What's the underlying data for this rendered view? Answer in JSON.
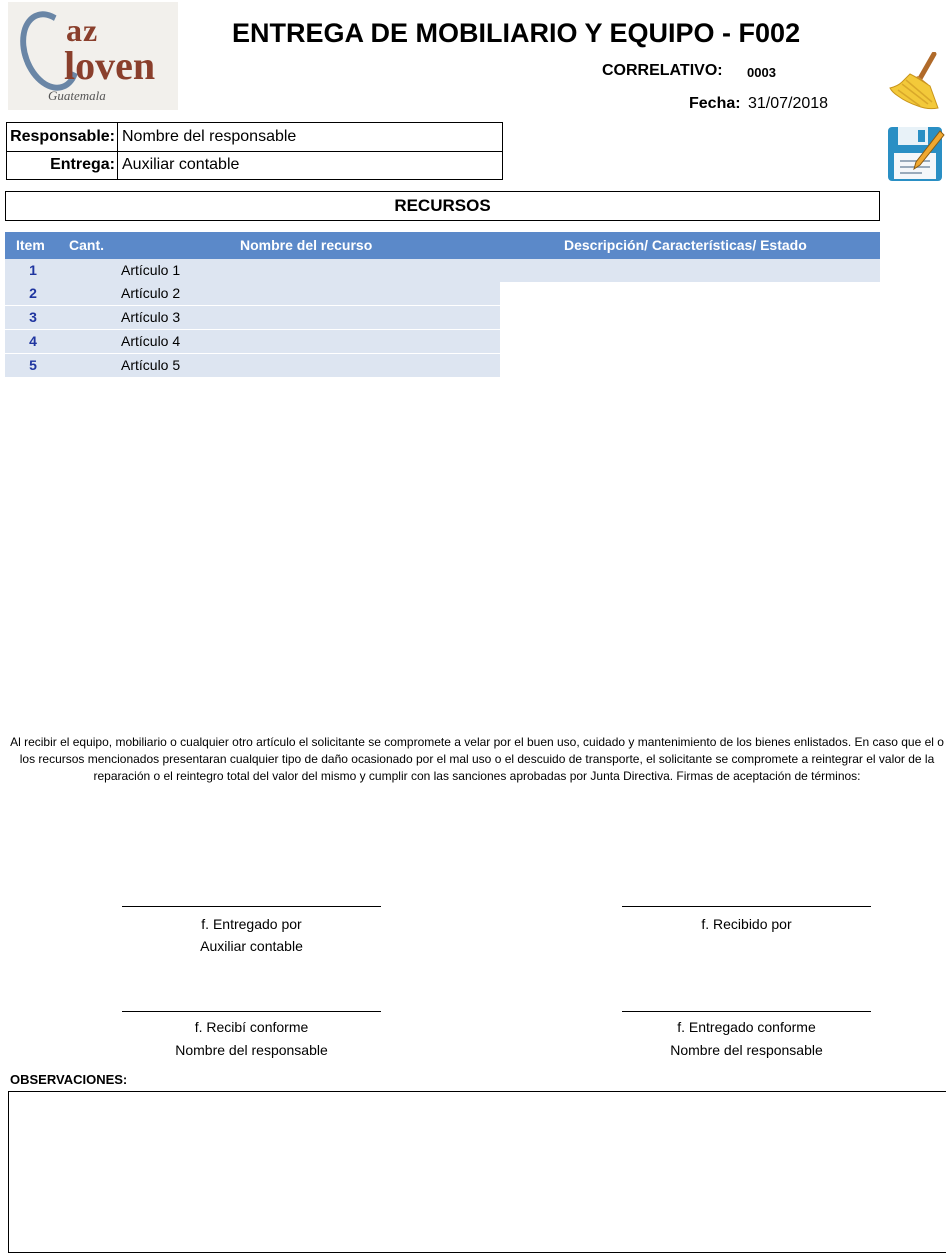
{
  "logo": {
    "line1": "az",
    "line2": "loven",
    "line3": "Guatemala"
  },
  "header": {
    "title": "ENTREGA DE MOBILIARIO Y EQUIPO - F002",
    "correlativo_label": "CORRELATIVO:",
    "correlativo_value": "0003",
    "fecha_label": "Fecha:",
    "fecha_value": "31/07/2018"
  },
  "icons": {
    "clear": "broom-icon",
    "save": "save-disk-icon"
  },
  "info": {
    "responsable_label": "Responsable:",
    "responsable_value": "Nombre del responsable",
    "entrega_label": "Entrega:",
    "entrega_value": "Auxiliar contable"
  },
  "recursos": {
    "title": "RECURSOS",
    "columns": [
      "Item",
      "Cant.",
      "Nombre del recurso",
      "Descripción/ Características/ Estado"
    ],
    "rows": [
      {
        "item": "1",
        "cant": "",
        "nombre": "Artículo 1",
        "descripcion": ""
      },
      {
        "item": "2",
        "cant": "",
        "nombre": "Artículo 2",
        "descripcion": ""
      },
      {
        "item": "3",
        "cant": "",
        "nombre": "Artículo 3",
        "descripcion": ""
      },
      {
        "item": "4",
        "cant": "",
        "nombre": "Artículo 4",
        "descripcion": ""
      },
      {
        "item": "5",
        "cant": "",
        "nombre": "Artículo 5",
        "descripcion": ""
      }
    ]
  },
  "terms": {
    "text": "Al recibir el equipo, mobiliario o cualquier otro artículo el solicitante se compromete a velar por el buen uso, cuidado y mantenimiento de los bienes enlistados. En caso que el o los recursos mencionados presentaran cualquier tipo de daño ocasionado por el mal uso o el descuido de transporte, el solicitante se compromete a reintegrar el valor de la reparación o el reintegro total del valor del mismo y cumplir con las sanciones aprobadas por Junta Directiva. Firmas de aceptación de términos:"
  },
  "signatures": {
    "entregado_por": "f. Entregado por",
    "entregado_por_name": "Auxiliar contable",
    "recibido_por": "f. Recibido por",
    "recibi_conforme": "f. Recibí conforme",
    "recibi_conforme_name": "Nombre del responsable",
    "entregado_conforme": "f. Entregado conforme",
    "entregado_conforme_name": "Nombre del responsable"
  },
  "observaciones": {
    "label": "OBSERVACIONES:",
    "value": ""
  }
}
